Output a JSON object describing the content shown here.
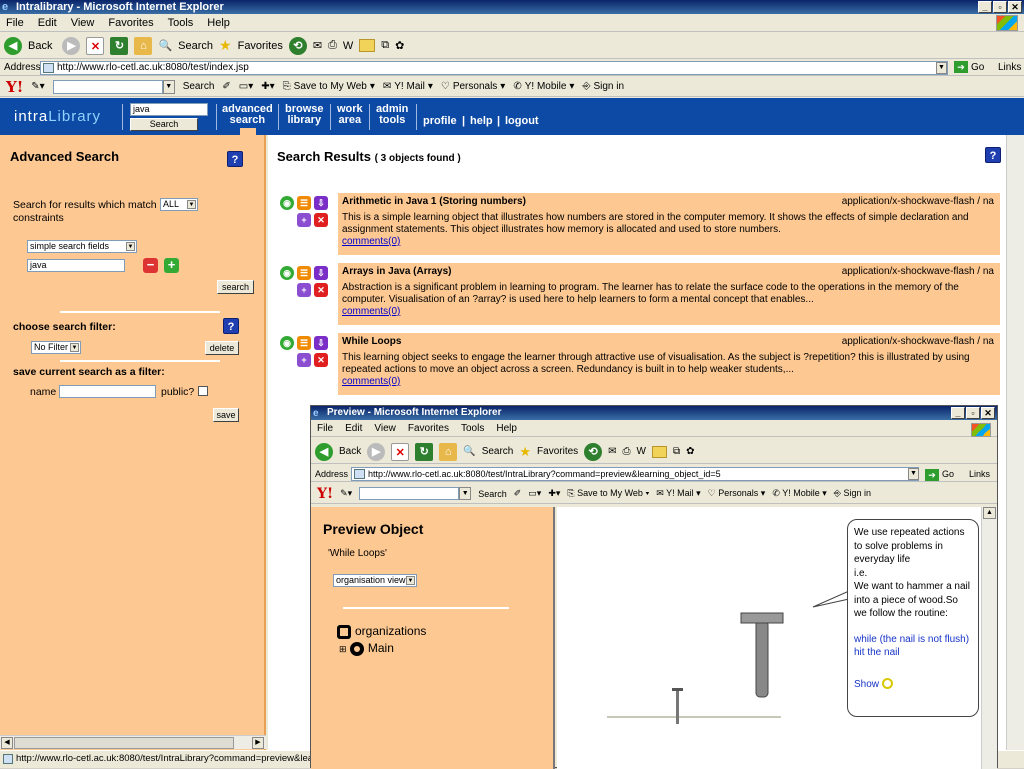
{
  "browser": {
    "title": "Intralibrary - Microsoft Internet Explorer",
    "menu": [
      "File",
      "Edit",
      "View",
      "Favorites",
      "Tools",
      "Help"
    ],
    "toolbar": {
      "back": "Back",
      "search": "Search",
      "favorites": "Favorites"
    },
    "address_label": "Address",
    "address": "http://www.rlo-cetl.ac.uk:8080/test/index.jsp",
    "go": "Go",
    "links": "Links",
    "yahoo": {
      "logo": "Y!",
      "search": "Search",
      "save": "Save to My Web",
      "mail": "Y! Mail",
      "personals": "Personals",
      "mobile": "Y! Mobile",
      "signin": "Sign in"
    },
    "status": "http://www.rlo-cetl.ac.uk:8080/test/IntraLibrary?command=preview&learni"
  },
  "app": {
    "logo_a": "intra",
    "logo_b": "Library",
    "query_value": "java",
    "query_button": "Search",
    "nav": [
      {
        "line1": "advanced",
        "line2": "search"
      },
      {
        "line1": "browse",
        "line2": "library"
      },
      {
        "line1": "work",
        "line2": "area"
      },
      {
        "line1": "admin",
        "line2": "tools"
      },
      {
        "line1": "profile"
      },
      {
        "line1": "help"
      },
      {
        "line1": "logout"
      }
    ]
  },
  "advanced": {
    "title": "Advanced Search",
    "match_text_a": "Search for results which match",
    "match_value": "ALL",
    "match_text_b": "constraints",
    "field_select": "simple search fields",
    "field_value": "java",
    "search_button": "search",
    "filter_label": "choose search filter:",
    "filter_value": "No Filter",
    "delete_button": "delete",
    "save_label": "save current search as a filter:",
    "name_label": "name",
    "public_label": "public?",
    "save_button": "save"
  },
  "results": {
    "title": "Search Results",
    "count": "( 3 objects found )",
    "items": [
      {
        "title": "Arithmetic in Java 1 (Storing numbers)",
        "mime": "application/x-shockwave-flash / na",
        "desc": "This is a simple learning object that illustrates how numbers are stored in the computer memory. It shows the effects of simple declaration and assignment statements. This object illustrates how memory is allocated and used to store numbers.",
        "comments": "comments(0)"
      },
      {
        "title": "Arrays in Java (Arrays)",
        "mime": "application/x-shockwave-flash / na",
        "desc": "Abstraction is a significant problem in learning to program. The learner has to relate the surface code to the operations in the memory of the computer. Visualisation of an ?array? is used here to help learners to form a mental concept that enables...",
        "comments": "comments(0)"
      },
      {
        "title": "While Loops",
        "mime": "application/x-shockwave-flash / na",
        "desc": "This learning object seeks to engage the learner through attractive use of visualisation. As the subject is ?repetition? this is illustrated by using repeated actions to move an object across a screen. Redundancy is built in to help weaker students,...",
        "comments": "comments(0)"
      }
    ]
  },
  "preview": {
    "window_title": "Preview - Microsoft Internet Explorer",
    "address": "http://www.rlo-cetl.ac.uk:8080/test/IntraLibrary?command=preview&learning_object_id=5",
    "heading": "Preview Object",
    "object_name": "'While Loops'",
    "view_select": "organisation view",
    "tree_root": "organizations",
    "tree_child": "Main",
    "bubble_lines": [
      "We use repeated actions to solve problems in everyday life",
      "i.e.",
      "We want to hammer a nail into a piece of wood.So we follow the routine:"
    ],
    "bubble_code": "while (the nail is not flush) hit the nail",
    "bubble_show": "Show"
  }
}
